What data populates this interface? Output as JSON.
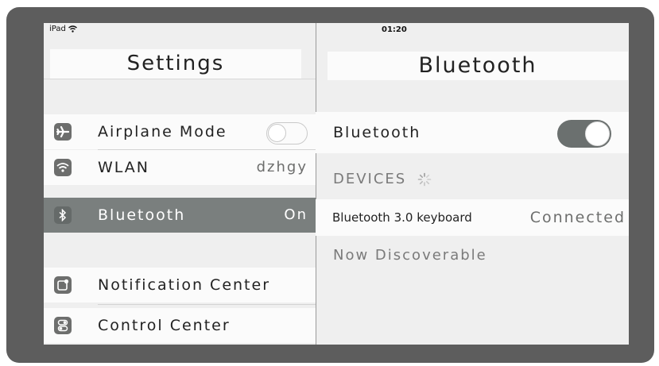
{
  "status_bar": {
    "device": "iPad",
    "time": "01:20"
  },
  "settings": {
    "title": "Settings",
    "items": [
      {
        "icon": "airplane-icon",
        "label": "Airplane Mode",
        "toggle": false
      },
      {
        "icon": "wifi-icon",
        "label": "WLAN",
        "value": "dzhgy"
      },
      {
        "icon": "bluetooth-icon",
        "label": "Bluetooth",
        "value": "On",
        "selected": true
      },
      {
        "icon": "notification-center-icon",
        "label": "Notification Center"
      },
      {
        "icon": "control-center-icon",
        "label": "Control Center"
      }
    ]
  },
  "bluetooth": {
    "title": "Bluetooth",
    "toggle_label": "Bluetooth",
    "toggle_on": true,
    "devices_header": "DEVICES",
    "devices": [
      {
        "name": "Bluetooth 3.0 keyboard",
        "status": "Connected"
      }
    ],
    "discoverable_text": "Now Discoverable"
  },
  "colors": {
    "bezel": "#5d5d5d",
    "selected_row": "#7a7f7e",
    "toggle_on": "#6b706f",
    "icon_bg": "#6d6e6d"
  }
}
